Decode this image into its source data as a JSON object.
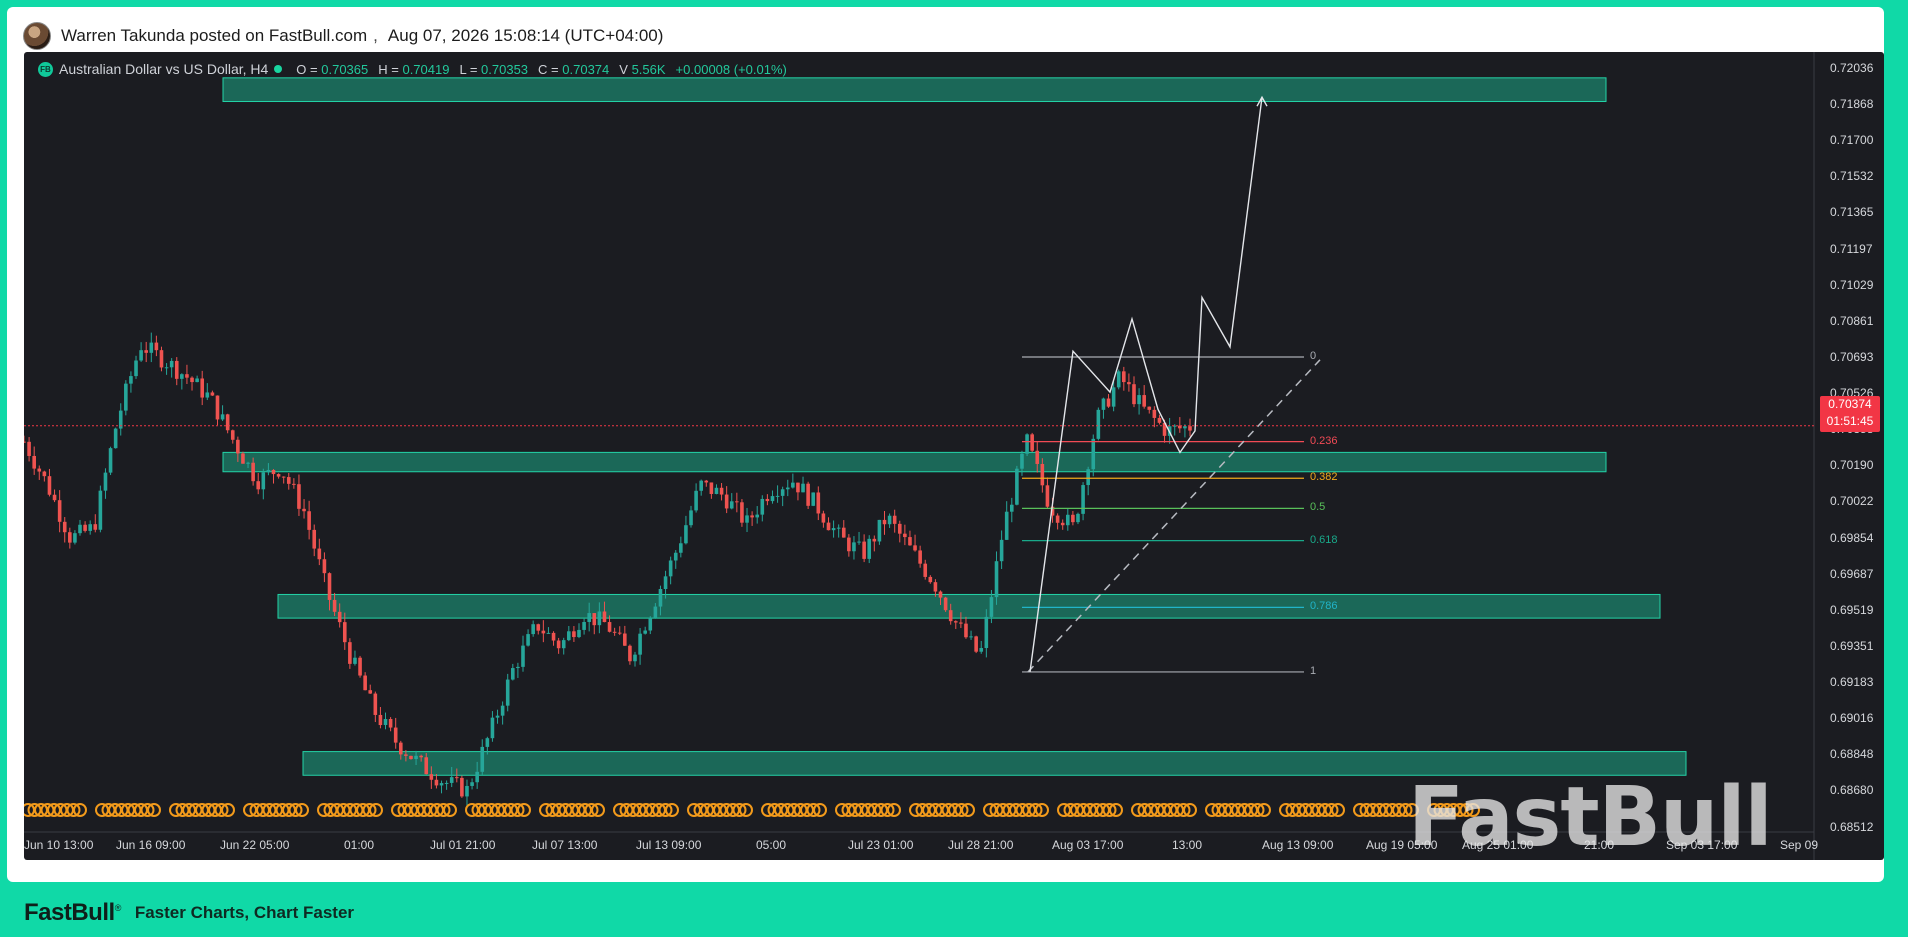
{
  "post": {
    "author_line": "Warren Takunda posted on FastBull.com",
    "separator": ",",
    "timestamp": "Aug 07, 2026 15:08:14 (UTC+04:00)"
  },
  "symbol": {
    "badge": "FB",
    "name": "Australian Dollar vs US Dollar, H4",
    "open_label": "O =",
    "open": "0.70365",
    "high_label": "H =",
    "high": "0.70419",
    "low_label": "L =",
    "low": "0.70353",
    "close_label": "C =",
    "close": "0.70374",
    "volume_label": "V",
    "volume": "5.56K",
    "change": "+0.00008 (+0.01%)"
  },
  "price_axis": [
    "0.72036",
    "0.71868",
    "0.71700",
    "0.71532",
    "0.71365",
    "0.71197",
    "0.71029",
    "0.70861",
    "0.70693",
    "0.70526",
    "0.70358",
    "0.70190",
    "0.70022",
    "0.69854",
    "0.69687",
    "0.69519",
    "0.69351",
    "0.69183",
    "0.69016",
    "0.68848",
    "0.68680",
    "0.68512"
  ],
  "current_price": {
    "price": "0.70374",
    "countdown": "01:51:45"
  },
  "time_axis": [
    "Jun 10 13:00",
    "Jun 16 09:00",
    "Jun 22 05:00",
    "01:00",
    "Jul 01 21:00",
    "Jul 07 13:00",
    "Jul 13 09:00",
    "05:00",
    "Jul 23 01:00",
    "Jul 28 21:00",
    "Aug 03 17:00",
    "13:00",
    "Aug 13 09:00",
    "Aug 19 05:00",
    "Aug 25 01:00",
    "21:00",
    "Sep 03 17:00",
    "Sep 09"
  ],
  "fib_levels": [
    {
      "label": "0",
      "price": 0.70693,
      "color": "#a9acb3"
    },
    {
      "label": "0.236",
      "price": 0.703,
      "color": "#f24a55"
    },
    {
      "label": "0.382",
      "price": 0.7013,
      "color": "#f2a91b"
    },
    {
      "label": "0.5",
      "price": 0.6999,
      "color": "#59c05a"
    },
    {
      "label": "0.618",
      "price": 0.6984,
      "color": "#19a98a"
    },
    {
      "label": "0.786",
      "price": 0.6953,
      "color": "#21b4c9"
    },
    {
      "label": "1",
      "price": 0.6923,
      "color": "#a9acb3"
    }
  ],
  "watermark": "FastBull",
  "footer": {
    "logo": "FastBull",
    "reg": "®",
    "tagline": "Faster Charts, Chart Faster"
  },
  "colors": {
    "bull": "#26a69a",
    "bear": "#ef5350",
    "zone": "#1ba887",
    "bg": "#1b1c21",
    "accent": "#10d9a7"
  },
  "chart_data": {
    "type": "candlestick",
    "title": "Australian Dollar vs US Dollar, H4",
    "ylim": [
      0.6844,
      0.7211
    ],
    "zones": [
      {
        "from": 0.7188,
        "to": 0.7199
      },
      {
        "from": 0.7016,
        "to": 0.7025
      },
      {
        "from": 0.6948,
        "to": 0.6959
      },
      {
        "from": 0.6875,
        "to": 0.6886
      }
    ],
    "projection_path": [
      0.6923,
      0.7072,
      0.7053,
      0.7087,
      0.7045,
      0.7025,
      0.7035,
      0.7097,
      0.7074,
      0.719
    ],
    "close_path": [
      0.703,
      0.701,
      0.6985,
      0.699,
      0.704,
      0.7075,
      0.7068,
      0.706,
      0.705,
      0.703,
      0.7012,
      0.7018,
      0.6998,
      0.696,
      0.693,
      0.6905,
      0.689,
      0.688,
      0.6872,
      0.6868,
      0.6895,
      0.6925,
      0.6945,
      0.6935,
      0.695,
      0.6945,
      0.693,
      0.6955,
      0.698,
      0.701,
      0.7005,
      0.6992,
      0.7008,
      0.7012,
      0.7,
      0.6985,
      0.6978,
      0.6995,
      0.698,
      0.6965,
      0.6945,
      0.693,
      0.699,
      0.703,
      0.7,
      0.699,
      0.704,
      0.706,
      0.7045,
      0.7035,
      0.7037
    ]
  }
}
